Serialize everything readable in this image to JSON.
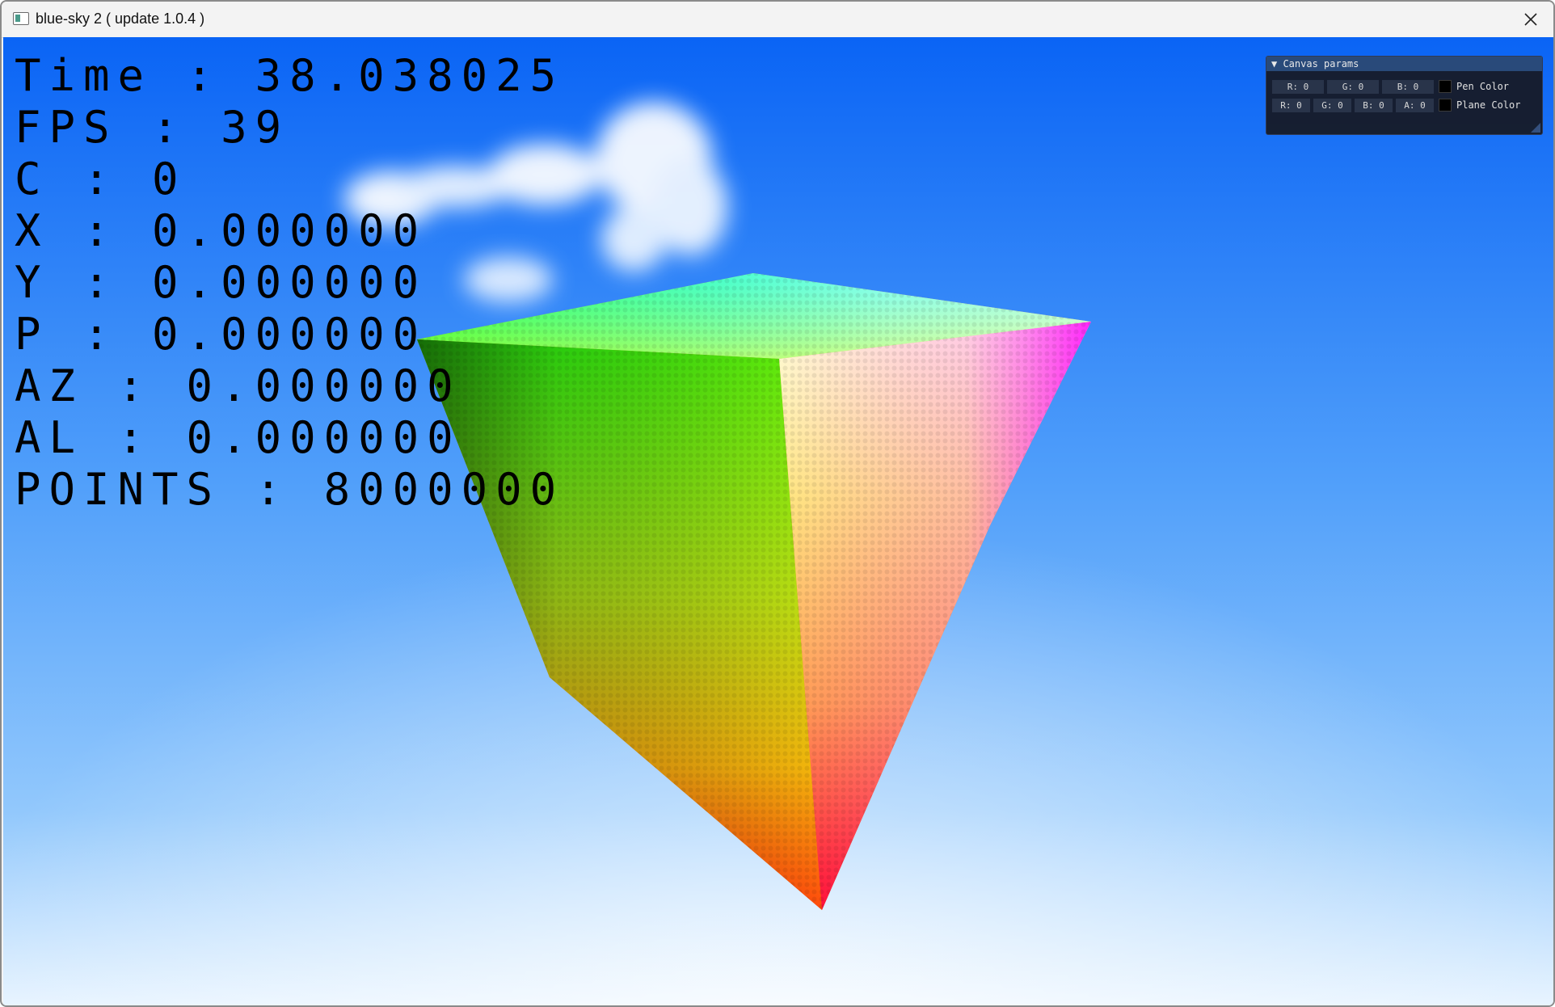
{
  "window": {
    "title": "blue-sky 2 ( update 1.0.4 )",
    "app_icon": "app-icon",
    "close_icon": "close-icon"
  },
  "hud": {
    "lines": [
      "Time : 38.038025",
      "FPS : 39",
      "C : 0",
      "X : 0.000000",
      "Y : 0.000000",
      "P : 0.000000",
      "AZ : 0.000000",
      "AL : 0.000000",
      "POINTS : 8000000"
    ]
  },
  "canvas_params": {
    "header": "▼ Canvas params",
    "pen": {
      "fields": [
        "R: 0",
        "G: 0",
        "B: 0"
      ],
      "label": "Pen Color",
      "swatch_color": "#000000"
    },
    "plane": {
      "fields": [
        "R: 0",
        "G: 0",
        "B: 0",
        "A: 0"
      ],
      "label": "Plane Color",
      "swatch_color": "#000000"
    }
  },
  "colors": {
    "sky_top": "#0a64f5",
    "sky_mid": "#56a7fb",
    "sky_bottom": "#e6f3ff",
    "panel_bg": "#161a24",
    "panel_header": "#294a7a"
  }
}
